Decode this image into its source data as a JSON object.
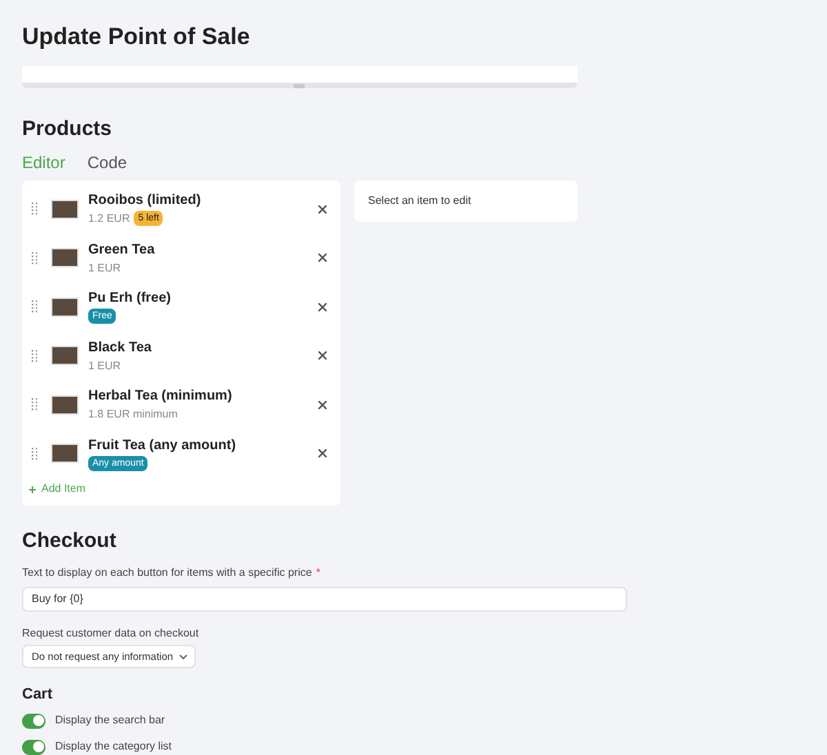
{
  "title": "Update Point of Sale",
  "products": {
    "heading": "Products",
    "tabs": [
      {
        "label": "Editor",
        "selected": true
      },
      {
        "label": "Code",
        "selected": false
      }
    ],
    "items": [
      {
        "name": "Rooibos (limited)",
        "price": "1.2 EUR",
        "badge": {
          "text": "5 left",
          "color": "#f5b335"
        }
      },
      {
        "name": "Green Tea",
        "price": "1 EUR"
      },
      {
        "name": "Pu Erh (free)",
        "badge": {
          "text": "Free",
          "color": "#1a8fa8"
        }
      },
      {
        "name": "Black Tea",
        "price": "1 EUR"
      },
      {
        "name": "Herbal Tea (minimum)",
        "price": "1.8 EUR minimum"
      },
      {
        "name": "Fruit Tea (any amount)",
        "badge": {
          "text": "Any amount",
          "color": "#1a8fa8"
        }
      }
    ],
    "add_item": "Add Item",
    "editor_hint": "Select an item to edit"
  },
  "checkout": {
    "heading": "Checkout",
    "button_text_label": "Text to display on each button for items with a specific price",
    "required_mark": "*",
    "button_text_value": "Buy for {0}",
    "customer_data_label": "Request customer data on checkout",
    "customer_data_value": "Do not request any information"
  },
  "cart": {
    "heading": "Cart",
    "toggles": [
      {
        "label": "Display the search bar",
        "on": true
      },
      {
        "label": "Display the category list",
        "on": true
      }
    ]
  }
}
